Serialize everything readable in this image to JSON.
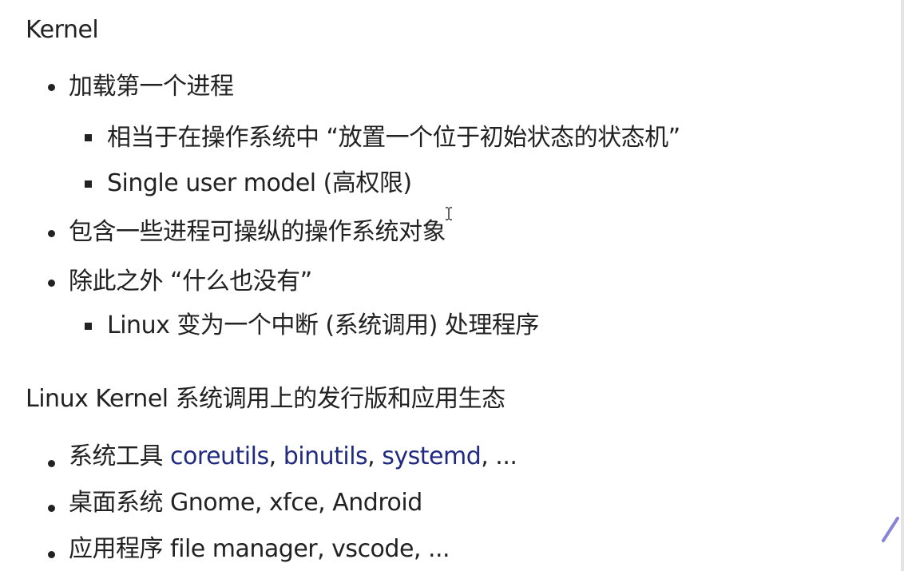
{
  "kernel": {
    "title": "Kernel",
    "items": [
      {
        "text": "加载第一个进程",
        "subitems": [
          "相当于在操作系统中 “放置一个位于初始状态的状态机”",
          "Single user model (高权限)"
        ]
      },
      {
        "text": "包含一些进程可操纵的操作系统对象",
        "subitems": []
      },
      {
        "text": "除此之外 “什么也没有”",
        "subitems": [
          "Linux 变为一个中断 (系统调用) 处理程序"
        ]
      }
    ]
  },
  "ecosystem": {
    "title": "Linux Kernel 系统调用上的发行版和应用生态",
    "items": [
      {
        "label": "系统工具 ",
        "links": [
          "coreutils",
          "binutils",
          "systemd"
        ],
        "sep": ", ",
        "suffix": ", ..."
      },
      {
        "label": "桌面系统 ",
        "rest": "Gnome, xfce, Android"
      },
      {
        "label": "应用程序 ",
        "rest": "file manager, vscode, ..."
      }
    ]
  },
  "colors": {
    "text": "#222222",
    "link": "#1f2a80",
    "pen_annotation": "#8a84d8"
  }
}
